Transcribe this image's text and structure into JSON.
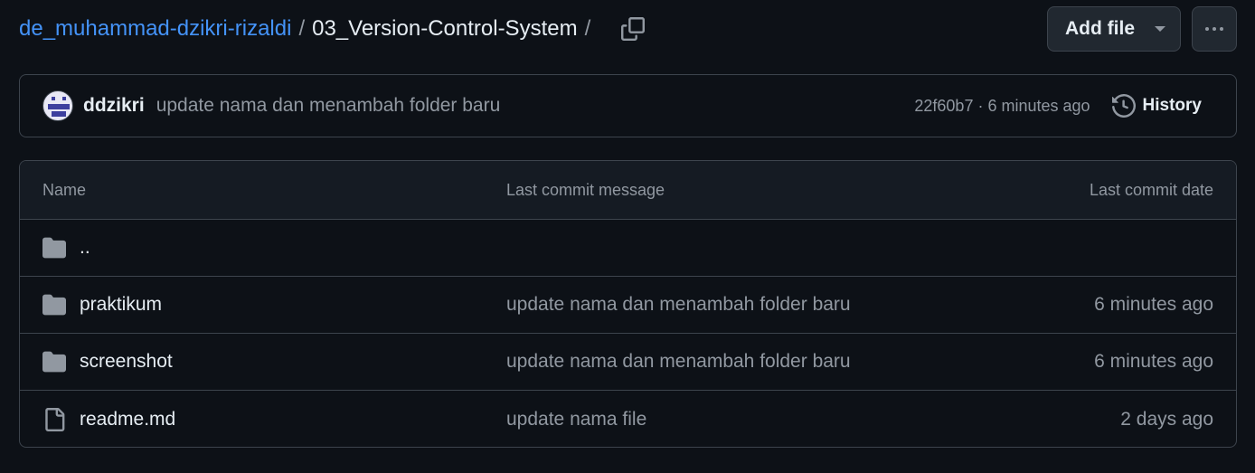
{
  "breadcrumb": {
    "owner": "de_muhammad-dzikri-rizaldi",
    "separator": "/",
    "current": "03_Version-Control-System",
    "trailing_separator": "/"
  },
  "toolbar": {
    "add_file_label": "Add file"
  },
  "latest_commit": {
    "author": "ddzikri",
    "message": "update nama dan menambah folder baru",
    "meta": "22f60b7 · 6 minutes ago",
    "history_label": "History"
  },
  "file_table": {
    "headers": {
      "name": "Name",
      "message": "Last commit message",
      "date": "Last commit date"
    },
    "rows": [
      {
        "name": "..",
        "type": "folder",
        "message": "",
        "date": ""
      },
      {
        "name": "praktikum",
        "type": "folder",
        "message": "update nama dan menambah folder baru",
        "date": "6 minutes ago"
      },
      {
        "name": "screenshot",
        "type": "folder",
        "message": "update nama dan menambah folder baru",
        "date": "6 minutes ago"
      },
      {
        "name": "readme.md",
        "type": "file",
        "message": "update nama file",
        "date": "2 days ago"
      }
    ]
  },
  "icons": {
    "copy": "copy-icon",
    "caret": "caret-down-icon",
    "more": "kebab-horizontal-icon",
    "history": "history-icon",
    "folder": "folder-icon",
    "file": "file-icon"
  },
  "colors": {
    "background": "#0d1117",
    "link": "#4493f8",
    "muted": "#9198a1",
    "border": "#3d444d"
  }
}
